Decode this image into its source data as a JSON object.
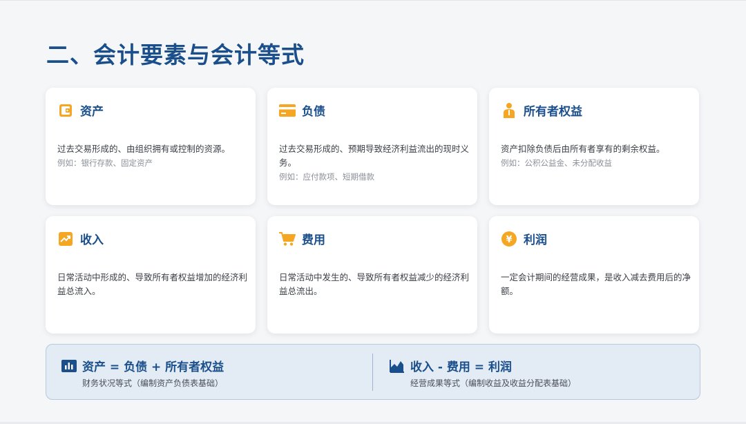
{
  "title": "二、会计要素与会计等式",
  "cards": [
    {
      "icon": "wallet-icon",
      "title": "资产",
      "desc": "过去交易形成的、由组织拥有或控制的资源。",
      "example": "例如：银行存款、固定资产"
    },
    {
      "icon": "credit-card-icon",
      "title": "负债",
      "desc": "过去交易形成的、预期导致经济利益流出的现时义务。",
      "example": "例如：应付款项、短期借款"
    },
    {
      "icon": "person-icon",
      "title": "所有者权益",
      "desc": "资产扣除负债后由所有者享有的剩余权益。",
      "example": "例如：公积公益金、未分配收益"
    },
    {
      "icon": "trending-up-icon",
      "title": "收入",
      "desc": "日常活动中形成的、导致所有者权益增加的经济利益总流入。",
      "example": ""
    },
    {
      "icon": "cart-icon",
      "title": "费用",
      "desc": "日常活动中发生的、导致所有者权益减少的经济利益总流出。",
      "example": ""
    },
    {
      "icon": "yen-coin-icon",
      "title": "利润",
      "desc": "一定会计期间的经营成果，是收入减去费用后的净额。",
      "example": ""
    }
  ],
  "formulas": [
    {
      "icon": "bar-chart-icon",
      "title": "资产 = 负债 + 所有者权益",
      "desc": "财务状况等式（编制资产负债表基础）"
    },
    {
      "icon": "area-chart-icon",
      "title": "收入 - 费用 = 利润",
      "desc": "经营成果等式（编制收益及收益分配表基础）"
    }
  ],
  "colors": {
    "primary": "#1a4f8b",
    "accent": "#f5a623",
    "panel": "#e3ebf4"
  }
}
